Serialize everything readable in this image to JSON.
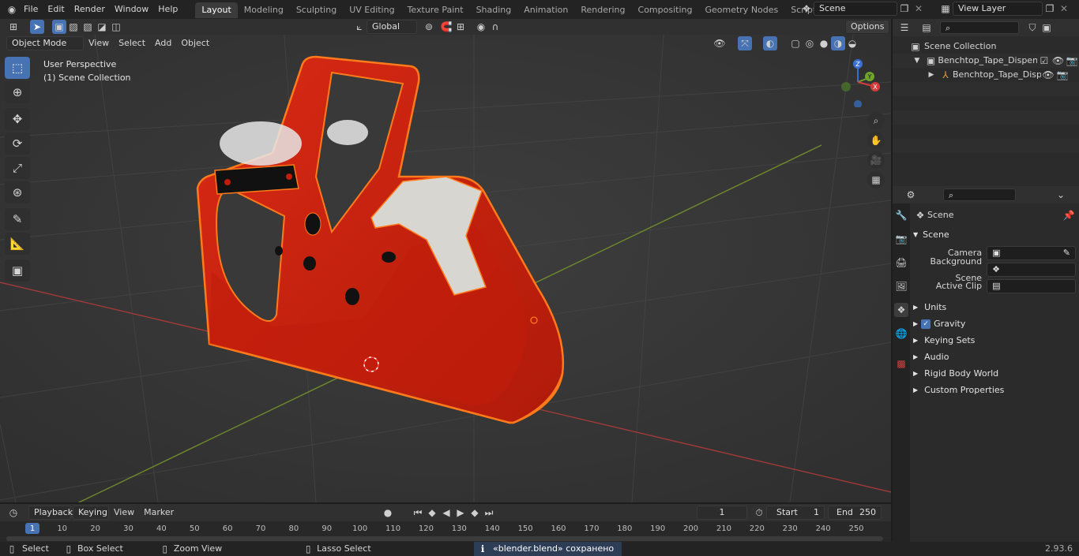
{
  "topbar": {
    "menus": [
      "File",
      "Edit",
      "Render",
      "Window",
      "Help"
    ],
    "workspaces": [
      "Layout",
      "Modeling",
      "Sculpting",
      "UV Editing",
      "Texture Paint",
      "Shading",
      "Animation",
      "Rendering",
      "Compositing",
      "Geometry Nodes",
      "Scripting"
    ],
    "active_workspace": "Layout",
    "scene_name": "Scene",
    "view_layer": "View Layer"
  },
  "viewport": {
    "mode": "Object Mode",
    "menus": [
      "View",
      "Select",
      "Add",
      "Object"
    ],
    "transform_orientation": "Global",
    "options_label": "Options",
    "overlay_title": "User Perspective",
    "overlay_subtitle": "(1) Scene Collection",
    "gizmo": {
      "z": "Z",
      "y": "Y",
      "x": "X"
    }
  },
  "outliner": {
    "root": "Scene Collection",
    "items": [
      "Benchtop_Tape_Dispenser_wi",
      "Benchtop_Tape_Dispense"
    ]
  },
  "properties": {
    "header": "Scene",
    "section": "Scene",
    "fields": [
      {
        "label": "Camera"
      },
      {
        "label": "Background Scene"
      },
      {
        "label": "Active Clip"
      }
    ],
    "panels": [
      "Units",
      "Gravity",
      "Keying Sets",
      "Audio",
      "Rigid Body World",
      "Custom Properties"
    ]
  },
  "timeline": {
    "menus": [
      "Playback",
      "Keying",
      "View",
      "Marker"
    ],
    "current_frame": "1",
    "start_label": "Start",
    "start": "1",
    "end_label": "End",
    "end": "250",
    "ticks": [
      "1",
      "10",
      "20",
      "30",
      "40",
      "50",
      "60",
      "70",
      "80",
      "90",
      "100",
      "110",
      "120",
      "130",
      "140",
      "150",
      "160",
      "170",
      "180",
      "190",
      "200",
      "210",
      "220",
      "230",
      "240",
      "250"
    ]
  },
  "status": {
    "select": "Select",
    "box_select": "Box Select",
    "zoom_view": "Zoom View",
    "lasso_select": "Lasso Select",
    "message": "«blender.blend» сохранено",
    "version": "2.93.6"
  },
  "colors": {
    "accent": "#4772b3",
    "object_red": "#c8200f",
    "selection_orange": "#ff7a1a"
  }
}
